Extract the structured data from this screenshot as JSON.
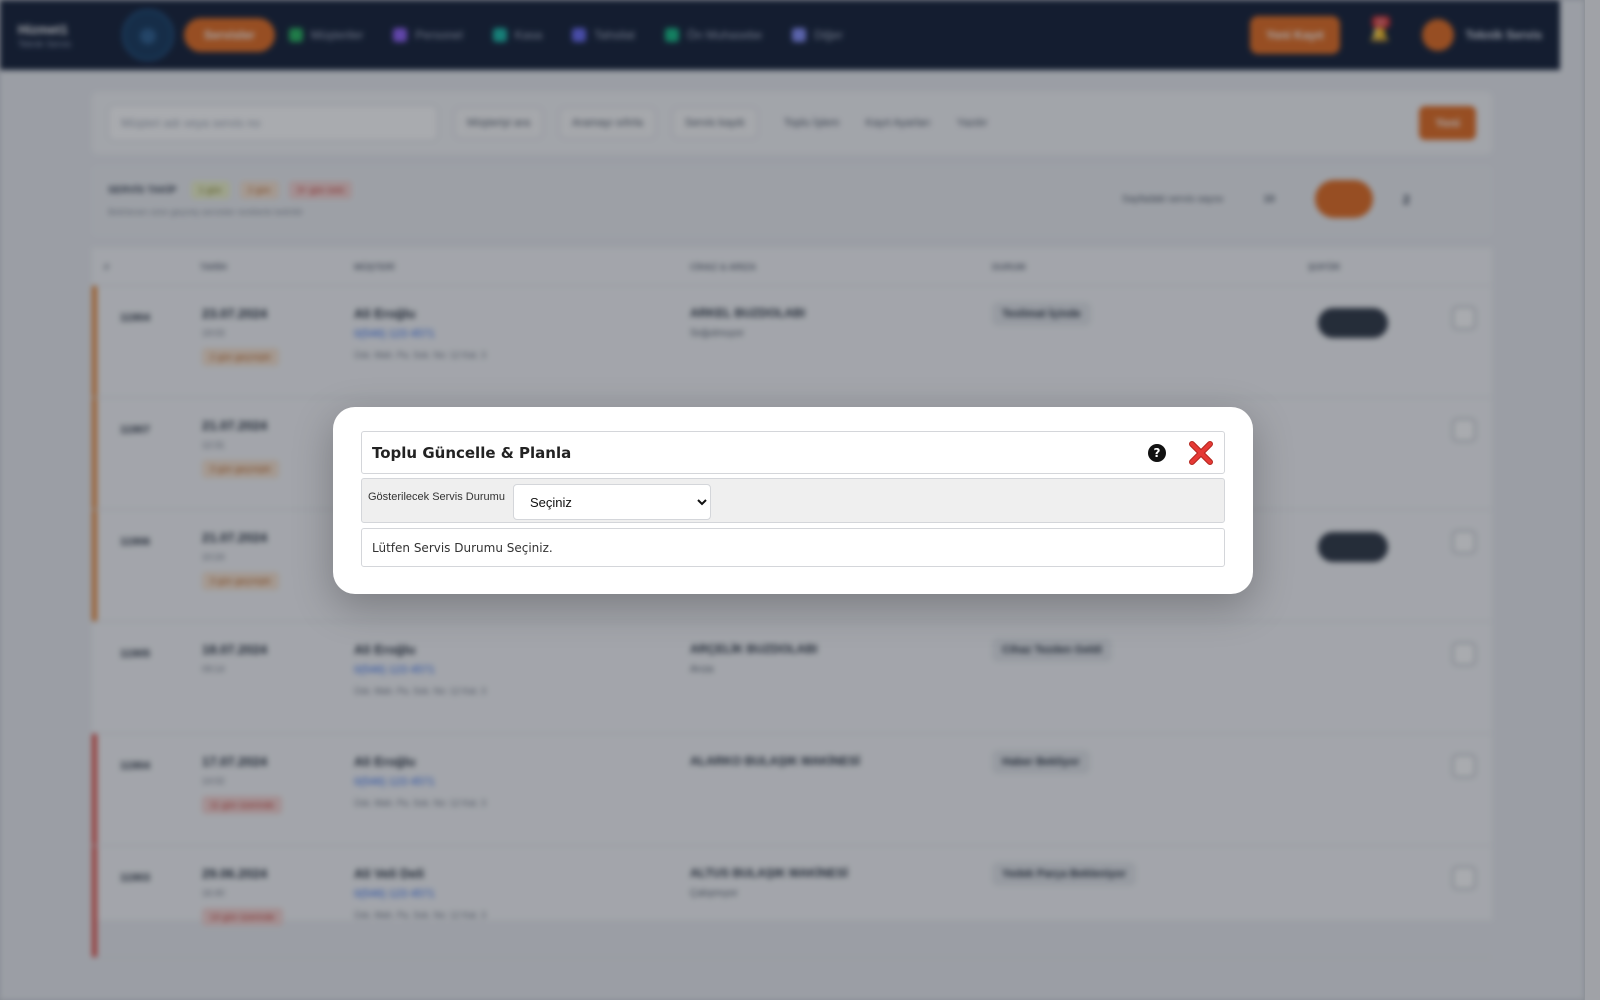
{
  "modal": {
    "title": "Toplu Güncelle & Planla",
    "filter_label": "Gösterilecek Servis Durumu",
    "select_value": "Seçiniz",
    "select_options": [
      "Seçiniz"
    ],
    "message": "Lütfen Servis Durumu Seçiniz.",
    "help_symbol": "?",
    "close_color": "#d93025"
  },
  "colors": {
    "brand_orange": "#e36a1d",
    "nav_dark": "#0f1b33",
    "stripe_orange": "#e8832f",
    "stripe_red": "#e0483e"
  },
  "background": {
    "nav": {
      "brand_title": "Hizmet1",
      "brand_sub": "Teknik Servis",
      "active_item": "Servisler",
      "items": [
        "Müşteriler",
        "Personel",
        "Kasa",
        "Tahsilat",
        "Ön Muhasebe",
        "Diğer"
      ],
      "cta": "Yeni Kayıt",
      "notif_count": "10",
      "user": "Teknik Servis"
    },
    "toolbar": {
      "search_placeholder": "Müşteri adı veya servis no",
      "chips": [
        "Müşteriyi ara",
        "Aramayı sıfırla",
        "Servis kaydı"
      ],
      "links": [
        "Toplu İşlem",
        "Kayıt Ayarları",
        "Yazdır"
      ],
      "new_button": "Yeni"
    },
    "legend": {
      "title": "SERVİS TAKİP",
      "badges": [
        "1 gün",
        "2 gün",
        "3+ gün üstü"
      ],
      "note": "Belirlenen süre geçmiş servisler renklerle belirtilir",
      "page_text": "Sayfadaki servis sayısı",
      "page_size": "10",
      "page_number": "2"
    },
    "table": {
      "headers": [
        "#",
        "TARİH",
        "MÜŞTERİ",
        "CİHAZ & ARIZA",
        "DURUM",
        "ŞOFÖR"
      ],
      "rows": [
        {
          "id": "11904",
          "date": "23.07.2024",
          "time": "19:03",
          "tag": "2 gün geçmiştir",
          "customer": "Ali Eroğlu",
          "phone": "0(546) 123 4571",
          "address": "Üsk. Mah. Pa. Sok. No: 12 Kat. 3",
          "device": "ARKEL BUZDOLABI",
          "device2": "Soğutmuyor",
          "status": "Teslimat İçinde",
          "stripe": "orange"
        },
        {
          "id": "11907",
          "date": "21.07.2024",
          "time": "12:31",
          "tag": "3 gün geçmiştir",
          "customer": "",
          "phone": "",
          "address": "",
          "device": "",
          "device2": "",
          "status": "",
          "stripe": "orange"
        },
        {
          "id": "11906",
          "date": "21.07.2024",
          "time": "10:24",
          "tag": "3 gün geçmiştir",
          "customer": "",
          "phone": "",
          "address": "",
          "device": "",
          "device2": "",
          "status": "",
          "stripe": "orange"
        },
        {
          "id": "11905",
          "date": "18.07.2024",
          "time": "09:14",
          "tag": "",
          "customer": "Ali Eroğlu",
          "phone": "0(546) 123 4571",
          "address": "Üsk. Mah. Pa. Sok. No: 12 Kat. 3",
          "device": "ARÇELİK BUZDOLABI",
          "device2": "Arıza",
          "status": "Cihaz Tezden Geldi",
          "stripe": "none"
        },
        {
          "id": "11904",
          "date": "17.07.2024",
          "time": "14:02",
          "tag": "11 gün üzerinde",
          "customer": "Ali Eroğlu",
          "phone": "0(546) 123 4571",
          "address": "Üsk. Mah. Pa. Sok. No: 12 Kat. 3",
          "device": "ALARKO BULAŞIK MAKİNESİ",
          "device2": "",
          "status": "Haber Bekliyor",
          "stripe": "red"
        },
        {
          "id": "11903",
          "date": "29.06.2024",
          "time": "16:40",
          "tag": "14 gün üzerinde",
          "customer": "Ali Veli Deli",
          "phone": "0(546) 123 4571",
          "address": "Üsk. Mah. Pa. Sok. No: 12 Kat. 3",
          "device": "ALTUS BULAŞIK MAKİNESİ",
          "device2": "Çalışmıyor",
          "status": "Yedek Parça Bekleniyor",
          "stripe": "red"
        }
      ]
    }
  }
}
